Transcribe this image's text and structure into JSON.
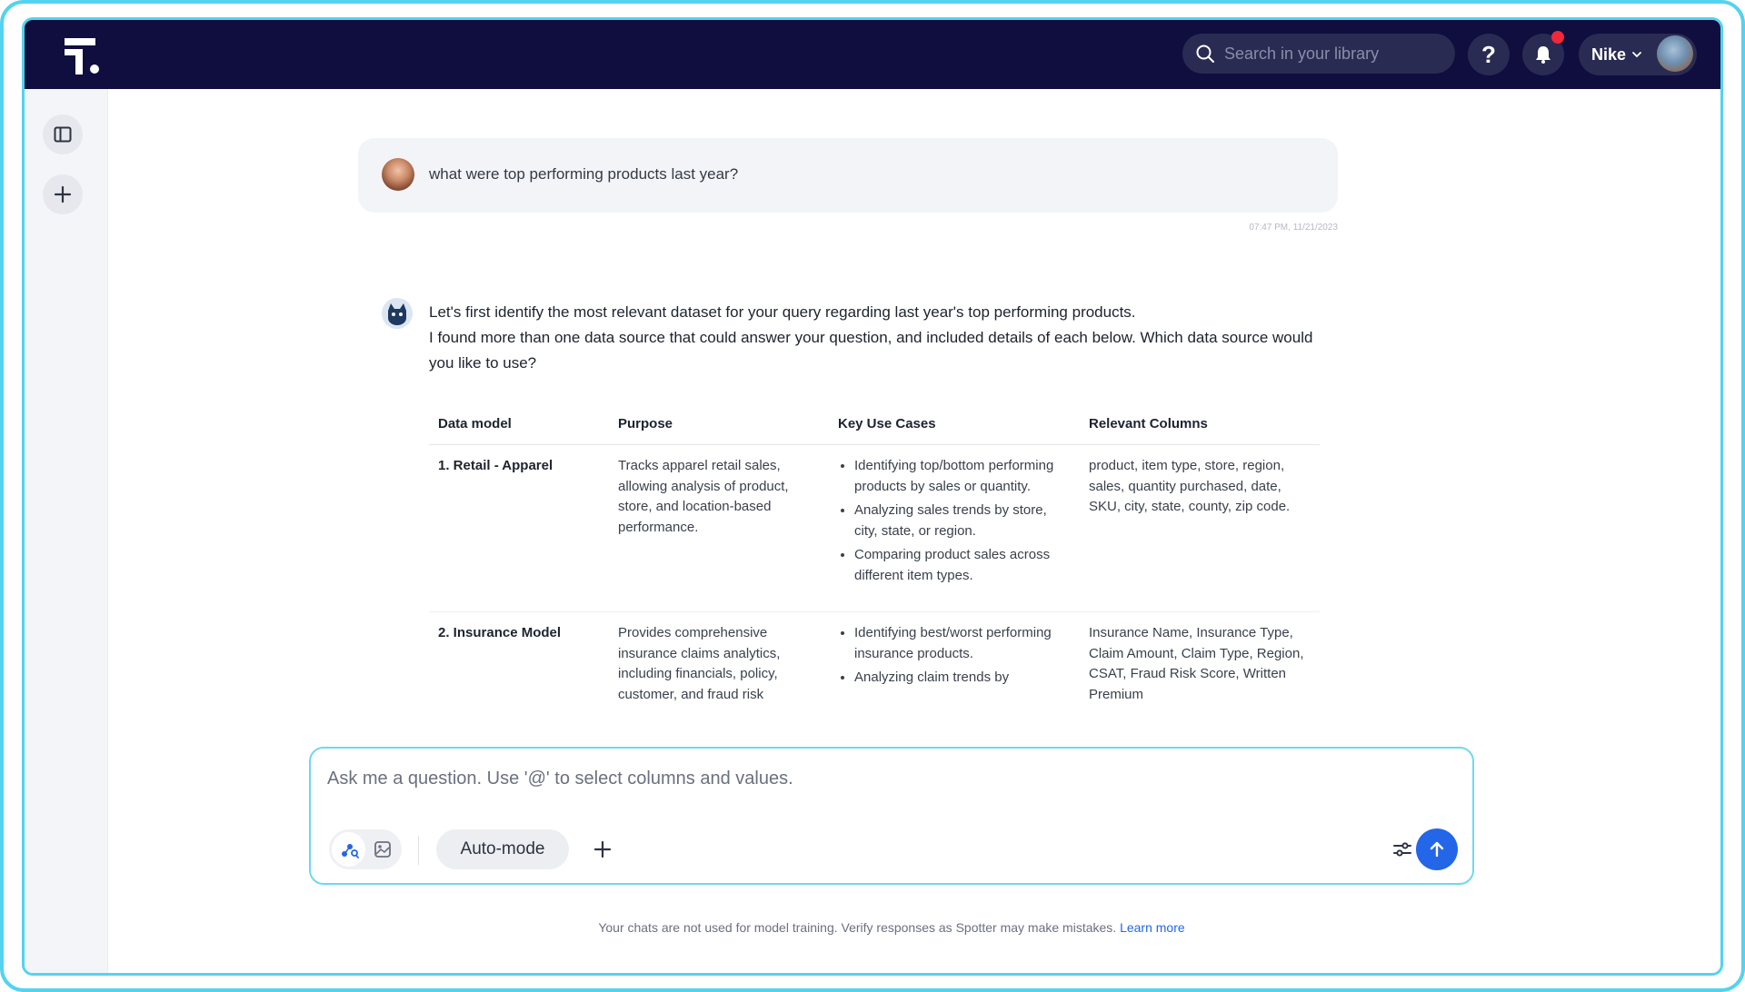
{
  "header": {
    "search_placeholder": "Search in your library",
    "help_label": "?",
    "org_name": "Nike"
  },
  "chat": {
    "user_message": "what were top performing products last year?",
    "timestamp": "07:47 PM, 11/21/2023",
    "assistant_message": {
      "line1": "Let's first identify the most relevant dataset for your query regarding last year's top performing products.",
      "line2": "I found more than one data source that could answer your question, and included details of each below. Which data source would you like to use?"
    },
    "table": {
      "headers": [
        "Data model",
        "Purpose",
        "Key Use Cases",
        "Relevant Columns"
      ],
      "rows": [
        {
          "model": "1. Retail - Apparel",
          "purpose": "Tracks apparel retail sales, allowing analysis of product, store, and location-based performance.",
          "use_cases": [
            "Identifying top/bottom performing products by sales or quantity.",
            "Analyzing sales trends by store, city, state, or region.",
            "Comparing product sales across different item types."
          ],
          "columns": "product, item type, store, region, sales, quantity purchased, date, SKU, city, state, county, zip code."
        },
        {
          "model": "2. Insurance Model",
          "purpose": "Provides comprehensive insurance claims analytics, including financials, policy, customer, and fraud risk",
          "use_cases": [
            "Identifying best/worst performing insurance products.",
            "Analyzing claim trends by"
          ],
          "columns": "Insurance Name, Insurance Type, Claim Amount, Claim Type, Region, CSAT, Fraud Risk Score, Written Premium"
        }
      ]
    }
  },
  "composer": {
    "placeholder": "Ask me a question. Use '@' to select columns and values.",
    "mode_label": "Auto-mode"
  },
  "footer": {
    "disclaimer": "Your chats are not used for model training. Verify responses as Spotter may make mistakes.",
    "learn_more": "Learn more"
  },
  "colors": {
    "topbar": "#0f0e3e",
    "accent": "#2366e8",
    "frame": "#53d3f0",
    "notification": "#f0283a"
  },
  "icons": [
    "logo-icon",
    "search-icon",
    "bell-icon",
    "chevron-down-icon",
    "sidebar-toggle-icon",
    "plus-icon",
    "bot-avatar",
    "data-mode-icon",
    "image-mode-icon",
    "sliders-icon",
    "arrow-up-icon"
  ]
}
